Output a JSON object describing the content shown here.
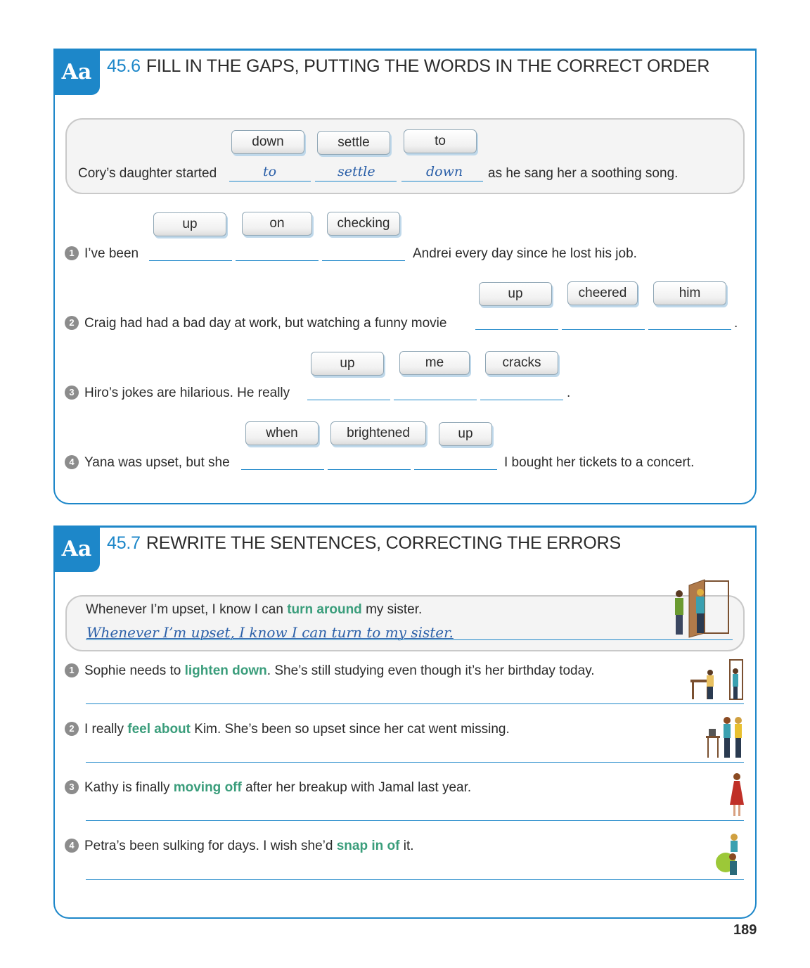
{
  "section1": {
    "badge": "Aa",
    "number": "45.6",
    "title": "FILL IN THE GAPS, PUTTING THE WORDS IN THE CORRECT ORDER",
    "example": {
      "chips": [
        "down",
        "settle",
        "to"
      ],
      "before": "Cory’s daughter started",
      "answers": [
        "to",
        "settle",
        "down"
      ],
      "after": "as he sang her a soothing song."
    },
    "items": [
      {
        "num": "1",
        "chips": [
          "up",
          "on",
          "checking"
        ],
        "before": "I’ve been",
        "after": "Andrei every day since he lost his job."
      },
      {
        "num": "2",
        "chips": [
          "up",
          "cheered",
          "him"
        ],
        "before": "Craig had had a bad day at work, but watching a funny movie",
        "after": "."
      },
      {
        "num": "3",
        "chips": [
          "up",
          "me",
          "cracks"
        ],
        "before": "Hiro’s jokes are hilarious. He really",
        "after": "."
      },
      {
        "num": "4",
        "chips": [
          "when",
          "brightened",
          "up"
        ],
        "before": "Yana was upset, but she",
        "after": "I bought her tickets to a concert."
      }
    ]
  },
  "section2": {
    "badge": "Aa",
    "number": "45.7",
    "title": "REWRITE THE SENTENCES, CORRECTING THE ERRORS",
    "example": {
      "before": "Whenever I’m upset, I know I can",
      "highlight": "turn around",
      "after": "my sister.",
      "answer": "Whenever I’m upset, I know I can turn to my sister."
    },
    "items": [
      {
        "num": "1",
        "before": "Sophie needs to",
        "highlight": "lighten down",
        "after": ". She’s still studying even though it’s her birthday today."
      },
      {
        "num": "2",
        "before": "I really",
        "highlight": "feel about",
        "after": "Kim. She’s been so upset since her cat went missing."
      },
      {
        "num": "3",
        "before": "Kathy is finally",
        "highlight": "moving off",
        "after": "after her breakup with Jamal last year."
      },
      {
        "num": "4",
        "before": "Petra’s been sulking for days. I wish she’d",
        "highlight": "snap in of",
        "after": "it."
      }
    ]
  },
  "page_number": "189",
  "colors": {
    "accent": "#1d87c9",
    "highlight": "#3a9d7b",
    "handwriting": "#2a5fa8"
  },
  "icons": [
    "people-at-door-illustration",
    "girl-at-desk-illustration",
    "friends-comforting-illustration",
    "woman-in-red-dress-illustration",
    "friends-cheering-illustration"
  ]
}
